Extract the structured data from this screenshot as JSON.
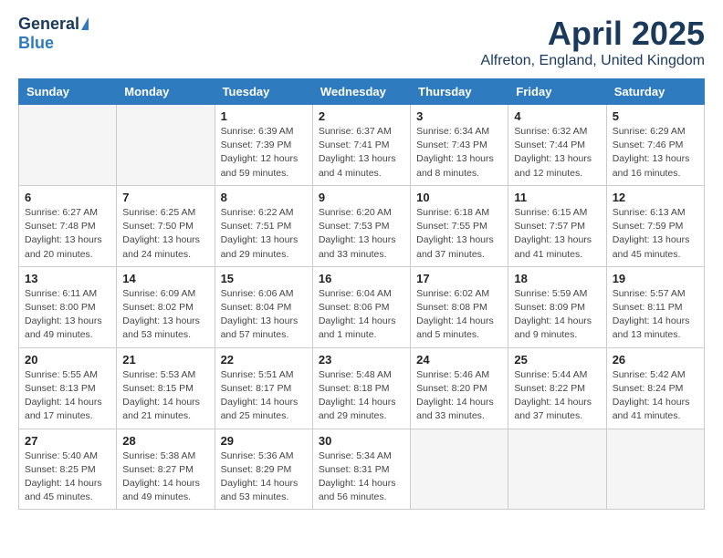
{
  "logo": {
    "general": "General",
    "blue": "Blue"
  },
  "header": {
    "title": "April 2025",
    "location": "Alfreton, England, United Kingdom"
  },
  "weekdays": [
    "Sunday",
    "Monday",
    "Tuesday",
    "Wednesday",
    "Thursday",
    "Friday",
    "Saturday"
  ],
  "weeks": [
    [
      {
        "day": "",
        "info": ""
      },
      {
        "day": "",
        "info": ""
      },
      {
        "day": "1",
        "info": "Sunrise: 6:39 AM\nSunset: 7:39 PM\nDaylight: 12 hours and 59 minutes."
      },
      {
        "day": "2",
        "info": "Sunrise: 6:37 AM\nSunset: 7:41 PM\nDaylight: 13 hours and 4 minutes."
      },
      {
        "day": "3",
        "info": "Sunrise: 6:34 AM\nSunset: 7:43 PM\nDaylight: 13 hours and 8 minutes."
      },
      {
        "day": "4",
        "info": "Sunrise: 6:32 AM\nSunset: 7:44 PM\nDaylight: 13 hours and 12 minutes."
      },
      {
        "day": "5",
        "info": "Sunrise: 6:29 AM\nSunset: 7:46 PM\nDaylight: 13 hours and 16 minutes."
      }
    ],
    [
      {
        "day": "6",
        "info": "Sunrise: 6:27 AM\nSunset: 7:48 PM\nDaylight: 13 hours and 20 minutes."
      },
      {
        "day": "7",
        "info": "Sunrise: 6:25 AM\nSunset: 7:50 PM\nDaylight: 13 hours and 24 minutes."
      },
      {
        "day": "8",
        "info": "Sunrise: 6:22 AM\nSunset: 7:51 PM\nDaylight: 13 hours and 29 minutes."
      },
      {
        "day": "9",
        "info": "Sunrise: 6:20 AM\nSunset: 7:53 PM\nDaylight: 13 hours and 33 minutes."
      },
      {
        "day": "10",
        "info": "Sunrise: 6:18 AM\nSunset: 7:55 PM\nDaylight: 13 hours and 37 minutes."
      },
      {
        "day": "11",
        "info": "Sunrise: 6:15 AM\nSunset: 7:57 PM\nDaylight: 13 hours and 41 minutes."
      },
      {
        "day": "12",
        "info": "Sunrise: 6:13 AM\nSunset: 7:59 PM\nDaylight: 13 hours and 45 minutes."
      }
    ],
    [
      {
        "day": "13",
        "info": "Sunrise: 6:11 AM\nSunset: 8:00 PM\nDaylight: 13 hours and 49 minutes."
      },
      {
        "day": "14",
        "info": "Sunrise: 6:09 AM\nSunset: 8:02 PM\nDaylight: 13 hours and 53 minutes."
      },
      {
        "day": "15",
        "info": "Sunrise: 6:06 AM\nSunset: 8:04 PM\nDaylight: 13 hours and 57 minutes."
      },
      {
        "day": "16",
        "info": "Sunrise: 6:04 AM\nSunset: 8:06 PM\nDaylight: 14 hours and 1 minute."
      },
      {
        "day": "17",
        "info": "Sunrise: 6:02 AM\nSunset: 8:08 PM\nDaylight: 14 hours and 5 minutes."
      },
      {
        "day": "18",
        "info": "Sunrise: 5:59 AM\nSunset: 8:09 PM\nDaylight: 14 hours and 9 minutes."
      },
      {
        "day": "19",
        "info": "Sunrise: 5:57 AM\nSunset: 8:11 PM\nDaylight: 14 hours and 13 minutes."
      }
    ],
    [
      {
        "day": "20",
        "info": "Sunrise: 5:55 AM\nSunset: 8:13 PM\nDaylight: 14 hours and 17 minutes."
      },
      {
        "day": "21",
        "info": "Sunrise: 5:53 AM\nSunset: 8:15 PM\nDaylight: 14 hours and 21 minutes."
      },
      {
        "day": "22",
        "info": "Sunrise: 5:51 AM\nSunset: 8:17 PM\nDaylight: 14 hours and 25 minutes."
      },
      {
        "day": "23",
        "info": "Sunrise: 5:48 AM\nSunset: 8:18 PM\nDaylight: 14 hours and 29 minutes."
      },
      {
        "day": "24",
        "info": "Sunrise: 5:46 AM\nSunset: 8:20 PM\nDaylight: 14 hours and 33 minutes."
      },
      {
        "day": "25",
        "info": "Sunrise: 5:44 AM\nSunset: 8:22 PM\nDaylight: 14 hours and 37 minutes."
      },
      {
        "day": "26",
        "info": "Sunrise: 5:42 AM\nSunset: 8:24 PM\nDaylight: 14 hours and 41 minutes."
      }
    ],
    [
      {
        "day": "27",
        "info": "Sunrise: 5:40 AM\nSunset: 8:25 PM\nDaylight: 14 hours and 45 minutes."
      },
      {
        "day": "28",
        "info": "Sunrise: 5:38 AM\nSunset: 8:27 PM\nDaylight: 14 hours and 49 minutes."
      },
      {
        "day": "29",
        "info": "Sunrise: 5:36 AM\nSunset: 8:29 PM\nDaylight: 14 hours and 53 minutes."
      },
      {
        "day": "30",
        "info": "Sunrise: 5:34 AM\nSunset: 8:31 PM\nDaylight: 14 hours and 56 minutes."
      },
      {
        "day": "",
        "info": ""
      },
      {
        "day": "",
        "info": ""
      },
      {
        "day": "",
        "info": ""
      }
    ]
  ]
}
